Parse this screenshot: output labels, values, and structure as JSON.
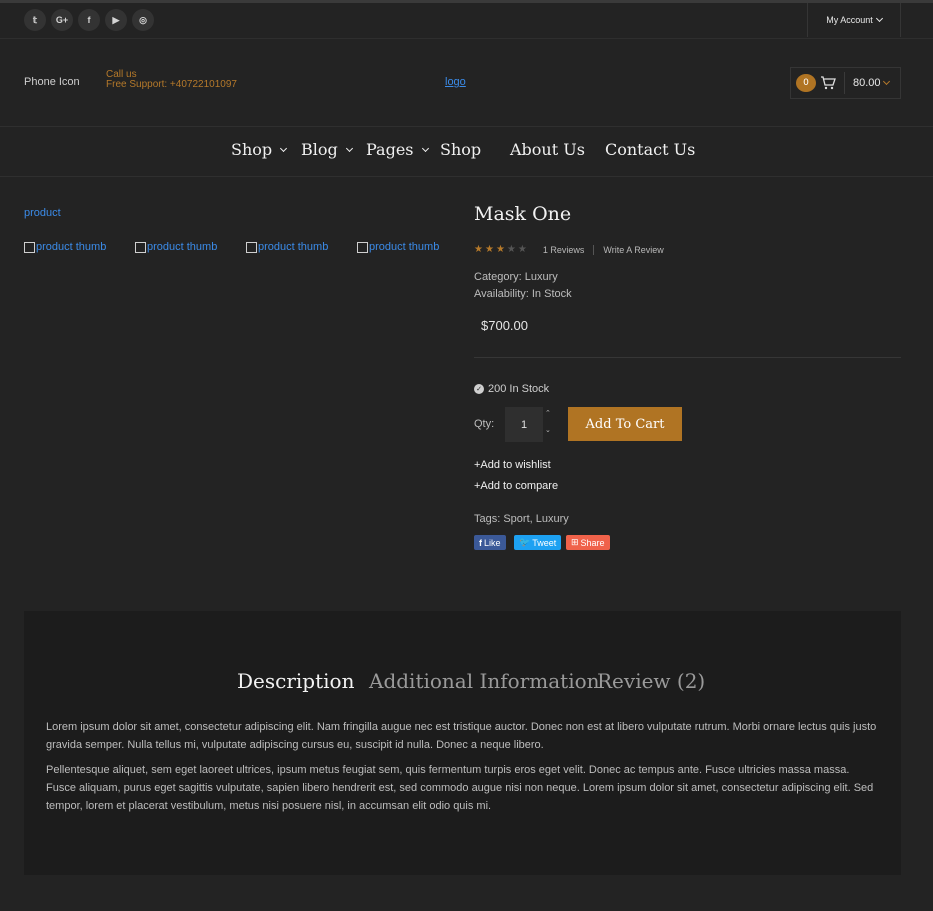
{
  "topbar": {
    "social": [
      "twitter",
      "google-plus",
      "facebook",
      "youtube",
      "instagram"
    ],
    "social_glyphs": [
      "𝕥",
      "G+",
      "f",
      "▶",
      "◎"
    ],
    "account_label": "My Account"
  },
  "header": {
    "phone_icon_alt": "Phone Icon",
    "call_label": "Call us",
    "support_label": "Free Support: +40722101097",
    "logo_alt": "logo",
    "cart_count": "0",
    "cart_total": "80.00"
  },
  "nav": {
    "items": [
      {
        "label": "Shop",
        "dropdown": true
      },
      {
        "label": "Blog",
        "dropdown": true
      },
      {
        "label": "Pages",
        "dropdown": true
      },
      {
        "label": "Shop",
        "dropdown": false
      },
      {
        "label": "About Us",
        "dropdown": false
      },
      {
        "label": "Contact Us",
        "dropdown": false
      }
    ]
  },
  "gallery": {
    "main_alt": "product",
    "thumbs": [
      "product thumb",
      "product thumb",
      "product thumb",
      "product thumb"
    ]
  },
  "product": {
    "title": "Mask One",
    "rating": 3,
    "rating_max": 5,
    "reviews_label": "1 Reviews",
    "write_review_label": "Write A Review",
    "category": "Category: Luxury",
    "availability": "Availability: In Stock",
    "price": "$700.00",
    "stock": "200 In Stock",
    "qty_label": "Qty:",
    "qty_value": "1",
    "add_to_cart": "Add To Cart",
    "wishlist": "+Add to wishlist",
    "compare": "+Add to compare",
    "tags": "Tags: Sport, Luxury",
    "share": {
      "like": "Like",
      "tweet": "Tweet",
      "share": "Share"
    }
  },
  "colors": {
    "accent": "#b07423",
    "facebook": "#3b5998",
    "twitter": "#1da1f2",
    "share": "#f0624a"
  },
  "tabs": [
    {
      "label": "Description",
      "active": true
    },
    {
      "label": "Additional Information",
      "active": false
    },
    {
      "label": "Review (2)",
      "active": false
    }
  ],
  "description": {
    "p1": "Lorem ipsum dolor sit amet, consectetur adipiscing elit. Nam fringilla augue nec est tristique auctor. Donec non est at libero vulputate rutrum. Morbi ornare lectus quis justo gravida semper. Nulla tellus mi, vulputate adipiscing cursus eu, suscipit id nulla. Donec a neque libero.",
    "p2": "Pellentesque aliquet, sem eget laoreet ultrices, ipsum metus feugiat sem, quis fermentum turpis eros eget velit. Donec ac tempus ante. Fusce ultricies massa massa. Fusce aliquam, purus eget sagittis vulputate, sapien libero hendrerit est, sed commodo augue nisi non neque. Lorem ipsum dolor sit amet, consectetur adipiscing elit. Sed tempor, lorem et placerat vestibulum, metus nisi posuere nisl, in accumsan elit odio quis mi."
  }
}
